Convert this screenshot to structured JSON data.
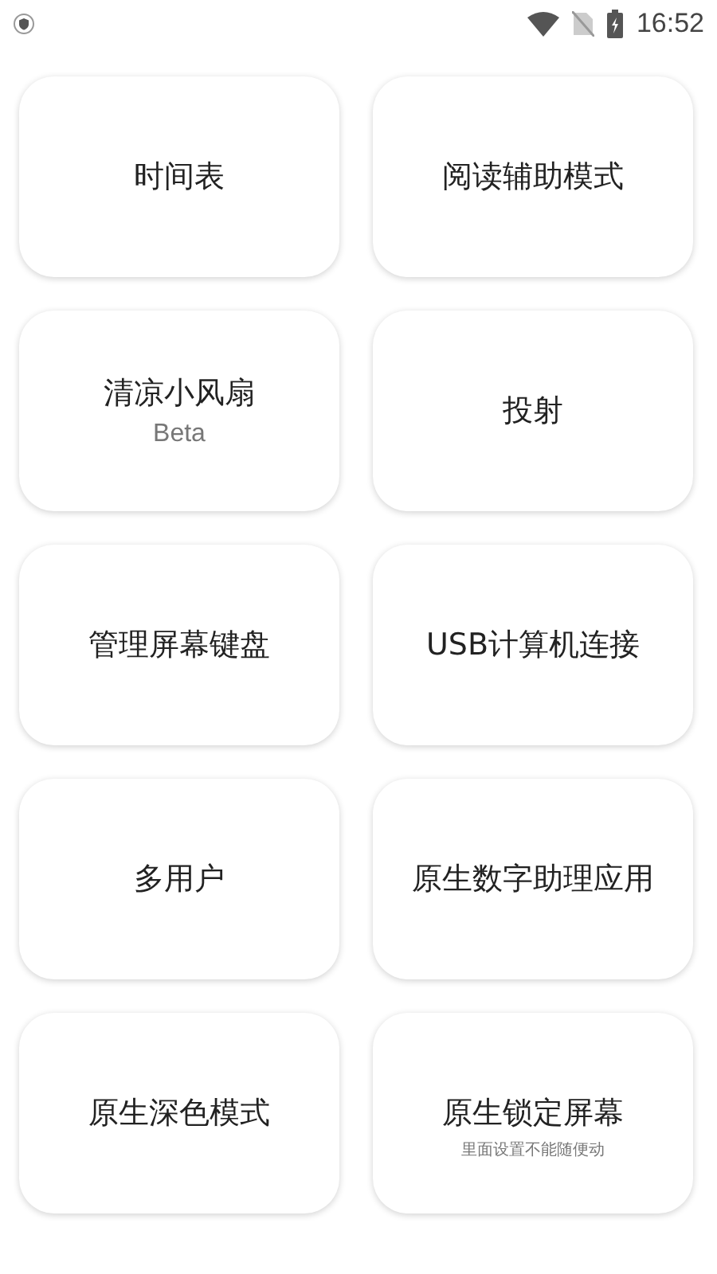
{
  "status_bar": {
    "time": "16:52"
  },
  "tiles": [
    {
      "title": "时间表"
    },
    {
      "title": "阅读辅助模式"
    },
    {
      "title": "清凉小风扇",
      "subtitle": "Beta",
      "kind": "latin"
    },
    {
      "title": "投射"
    },
    {
      "title": "管理屏幕键盘"
    },
    {
      "title": "USB计算机连接"
    },
    {
      "title": "多用户"
    },
    {
      "title": "原生数字助理应用"
    },
    {
      "title": "原生深色模式"
    },
    {
      "title": "原生锁定屏幕",
      "subtitle": "里面设置不能随便动",
      "kind": "note"
    }
  ]
}
